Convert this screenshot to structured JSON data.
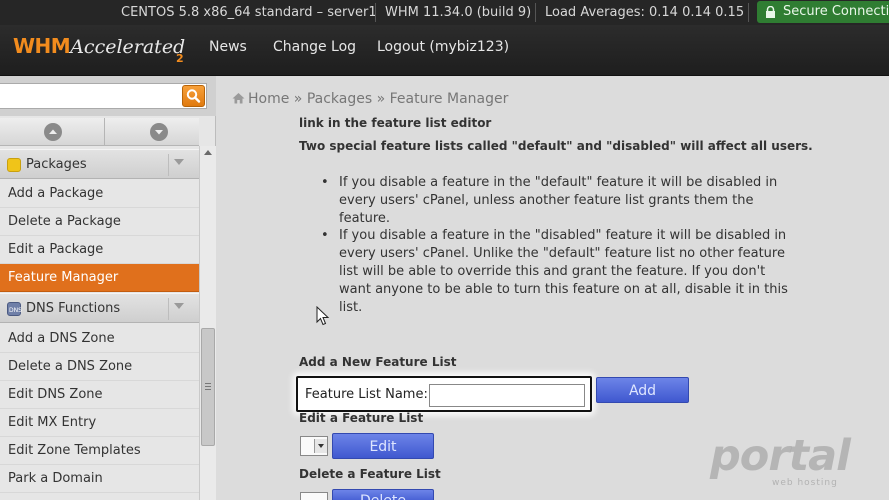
{
  "statusbar": {
    "server": "CENTOS 5.8 x86_64 standard – server1",
    "whm_version": "WHM 11.34.0 (build 9)",
    "load_averages": "Load Averages: 0.14 0.14 0.15",
    "secure": "Secure Connection"
  },
  "header": {
    "logo_whm": "WHM",
    "logo_accelerated": "Accelerated",
    "logo_two": "2",
    "nav": [
      "News",
      "Change Log",
      "Logout (mybiz123)"
    ]
  },
  "sidebar": {
    "search": {
      "value": "",
      "placeholder": ""
    },
    "groups": [
      {
        "label": "Packages",
        "icon": "packages-icon",
        "color": "#f0c419",
        "items": [
          "Add a Package",
          "Delete a Package",
          "Edit a Package",
          "Feature Manager"
        ]
      },
      {
        "label": "DNS Functions",
        "icon": "dns-icon",
        "color": "#6f7fa8",
        "items": [
          "Add a DNS Zone",
          "Delete a DNS Zone",
          "Edit DNS Zone",
          "Edit MX Entry",
          "Edit Zone Templates",
          "Park a Domain"
        ]
      }
    ],
    "active_item": "Feature Manager"
  },
  "breadcrumb": {
    "home": "Home",
    "sep": "»",
    "packages": "Packages",
    "current": "Feature Manager"
  },
  "content": {
    "line1": "link in the feature list editor",
    "line2": "Two special feature lists called \"default\" and \"disabled\" will affect all users.",
    "bullets": [
      "If you disable a feature in the \"default\" feature it will be disabled in every users' cPanel, unless another feature list grants them the feature.",
      "If you disable a feature in the \"disabled\" feature it will be disabled in every users' cPanel. Unlike the \"default\" feature list no other feature list will be able to override this and grant the feature. If you don't want anyone to be able to turn this feature on at all, disable it in this list."
    ],
    "add_heading": "Add a New Feature List",
    "feature_list_name_label": "Feature List Name:",
    "feature_list_name_value": "",
    "add_button": "Add",
    "edit_heading": "Edit a Feature List",
    "edit_button": "Edit",
    "delete_heading": "Delete a Feature List",
    "delete_button": "Delete"
  },
  "watermark": {
    "main": "portal",
    "sub": "web hosting"
  },
  "colors": {
    "accent": "#e0701c",
    "button_blue": "#4f68d8",
    "secure_green": "#2f7d32"
  }
}
